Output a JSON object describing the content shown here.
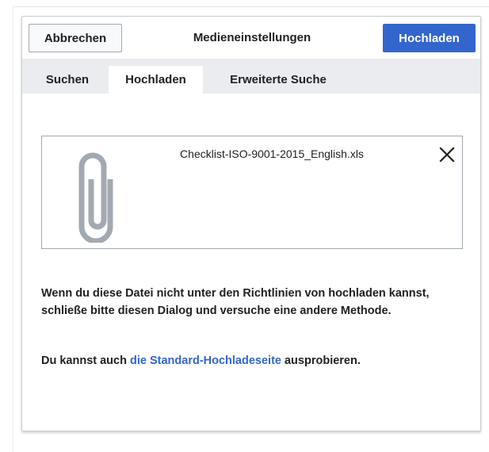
{
  "dialog": {
    "title": "Medieneinstellungen",
    "cancel_label": "Abbrechen",
    "upload_label": "Hochladen",
    "primary_color": "#3366cc"
  },
  "tabs": [
    {
      "label": "Suchen",
      "active": false
    },
    {
      "label": "Hochladen",
      "active": true
    },
    {
      "label": "Erweiterte Suche",
      "active": false
    }
  ],
  "file": {
    "name": "Checklist-ISO-9001-2015_English.xls",
    "icon": "paperclip-icon",
    "remove_icon": "close-icon"
  },
  "notice": {
    "text": "Wenn du diese Datei nicht unter den Richtlinien von hochladen kannst, schließe bitte diesen Dialog und versuche eine andere Methode.",
    "alt_prefix": "Du kannst auch ",
    "alt_link": "die Standard-Hochladeseite",
    "alt_suffix": " ausprobieren."
  }
}
